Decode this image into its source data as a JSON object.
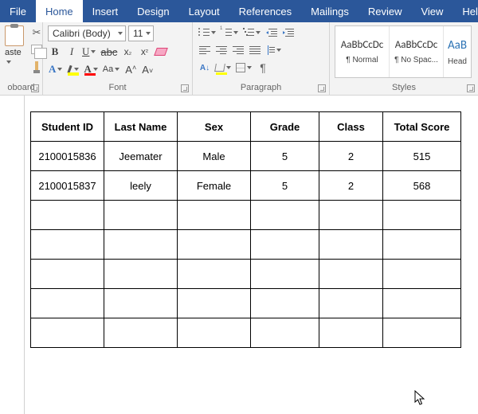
{
  "menubar": {
    "tabs": [
      "File",
      "Home",
      "Insert",
      "Design",
      "Layout",
      "References",
      "Mailings",
      "Review",
      "View",
      "Help"
    ],
    "active": "Home"
  },
  "ribbon": {
    "clipboard": {
      "paste": "aste",
      "group_label": "oboard"
    },
    "font": {
      "name": "Calibri (Body)",
      "size": "11",
      "group_label": "Font"
    },
    "paragraph": {
      "group_label": "Paragraph"
    },
    "styles": {
      "group_label": "Styles",
      "items": [
        {
          "preview": "AaBbCcDc",
          "name": "¶ Normal"
        },
        {
          "preview": "AaBbCcDc",
          "name": "¶ No Spac..."
        },
        {
          "preview": "AaB",
          "name": "Head"
        }
      ]
    }
  },
  "document": {
    "table": {
      "headers": [
        "Student ID",
        "Last Name",
        "Sex",
        "Grade",
        "Class",
        "Total Score"
      ],
      "rows": [
        [
          "2100015836",
          "Jeemater",
          "Male",
          "5",
          "2",
          "515"
        ],
        [
          "2100015837",
          "leely",
          "Female",
          "5",
          "2",
          "568"
        ],
        [
          "",
          "",
          "",
          "",
          "",
          ""
        ],
        [
          "",
          "",
          "",
          "",
          "",
          ""
        ],
        [
          "",
          "",
          "",
          "",
          "",
          ""
        ],
        [
          "",
          "",
          "",
          "",
          "",
          ""
        ],
        [
          "",
          "",
          "",
          "",
          "",
          ""
        ]
      ]
    }
  }
}
